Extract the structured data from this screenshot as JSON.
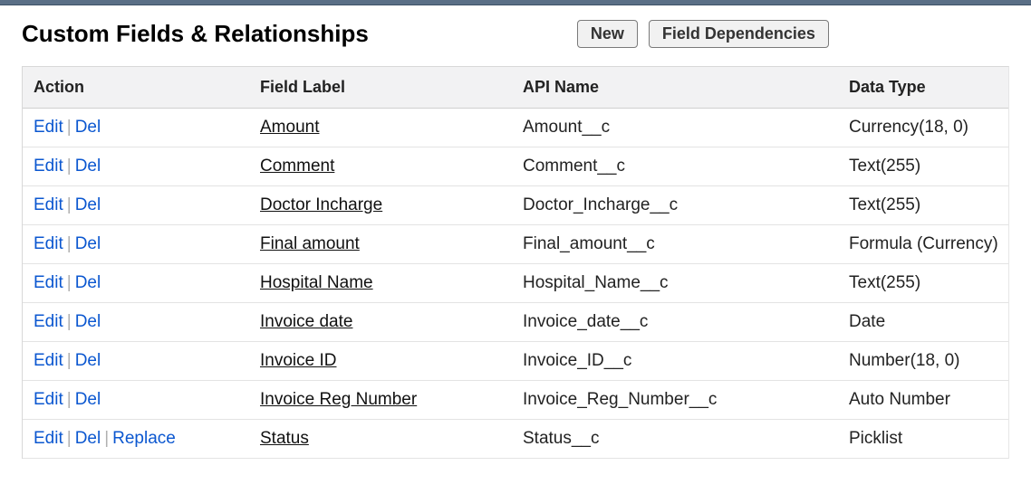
{
  "header": {
    "title": "Custom Fields & Relationships",
    "buttons": {
      "new": "New",
      "field_dependencies": "Field Dependencies"
    }
  },
  "table": {
    "columns": {
      "action": "Action",
      "field_label": "Field Label",
      "api_name": "API Name",
      "data_type": "Data Type"
    },
    "action_labels": {
      "edit": "Edit",
      "del": "Del",
      "replace": "Replace"
    },
    "rows": [
      {
        "label": "Amount",
        "api": "Amount__c",
        "type": "Currency(18, 0)",
        "replace": false
      },
      {
        "label": "Comment",
        "api": "Comment__c",
        "type": "Text(255)",
        "replace": false
      },
      {
        "label": "Doctor Incharge",
        "api": "Doctor_Incharge__c",
        "type": "Text(255)",
        "replace": false
      },
      {
        "label": "Final amount",
        "api": "Final_amount__c",
        "type": "Formula (Currency)",
        "replace": false
      },
      {
        "label": "Hospital Name",
        "api": "Hospital_Name__c",
        "type": "Text(255)",
        "replace": false
      },
      {
        "label": "Invoice date",
        "api": "Invoice_date__c",
        "type": "Date",
        "replace": false
      },
      {
        "label": "Invoice ID",
        "api": "Invoice_ID__c",
        "type": "Number(18, 0)",
        "replace": false
      },
      {
        "label": "Invoice Reg Number",
        "api": "Invoice_Reg_Number__c",
        "type": "Auto Number",
        "replace": false
      },
      {
        "label": "Status",
        "api": "Status__c",
        "type": "Picklist",
        "replace": true
      }
    ]
  }
}
